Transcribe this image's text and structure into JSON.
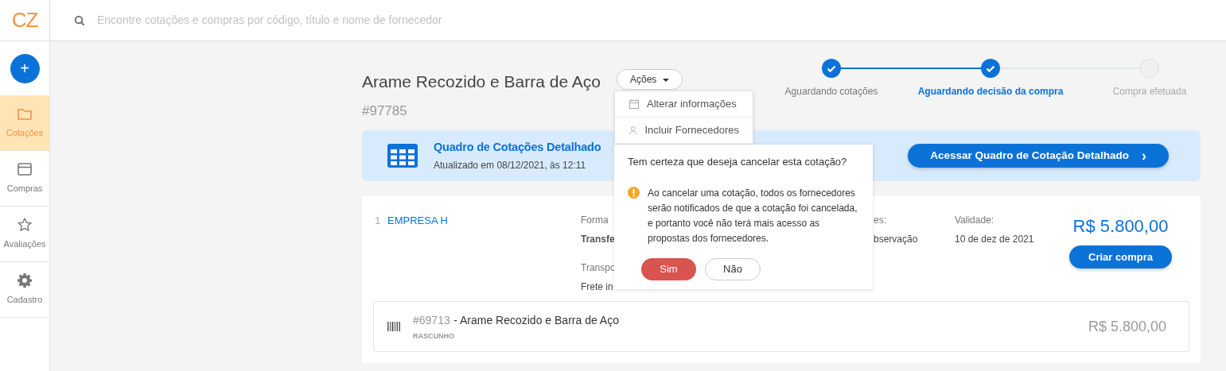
{
  "logo": {
    "text": "CZ"
  },
  "search": {
    "placeholder": "Encontre cotações e compras por código, título e nome de fornecedor"
  },
  "sidebar": {
    "add_button": "+",
    "items": [
      {
        "label": "Cotações",
        "selected": true
      },
      {
        "label": "Compras",
        "selected": false
      },
      {
        "label": "Avaliações",
        "selected": false
      },
      {
        "label": "Cadastro",
        "selected": false
      }
    ]
  },
  "header": {
    "title": "Arame Recozido e Barra de Aço",
    "code": "#97785",
    "actions_button": "Ações"
  },
  "actions_menu": {
    "items": [
      {
        "label": "Alterar informações"
      },
      {
        "label": "Incluir Fornecedores"
      }
    ],
    "confirm": {
      "question": "Tem certeza que deseja cancelar esta cotação?",
      "warning": "Ao cancelar uma cotação, todos os fornecedores serão notificados de que a cotação foi cancelada, e portanto você não terá mais acesso as propostas dos fornecedores.",
      "buttons": [
        {
          "label": "Sim",
          "kind": "danger"
        },
        {
          "label": "Não",
          "kind": "outline"
        }
      ]
    }
  },
  "steps": [
    {
      "label": "Aguardando cotações",
      "done": true,
      "selected": false
    },
    {
      "label": "Aguardando decisão da compra",
      "done": true,
      "selected": true
    },
    {
      "label": "Compra efetuada",
      "done": false,
      "selected": false
    }
  ],
  "banner": {
    "title": "Quadro de Cotações Detalhado",
    "subtitle": "Atualizado em 08/12/2021, às 12:11",
    "button": "Acessar Quadro de Cotação Detalhado",
    "button_icon": "›"
  },
  "supplier": {
    "index": "1",
    "name": "EMPRESA H",
    "columns": [
      {
        "lines": [
          {
            "text": "Forma",
            "kind": "label"
          },
          {
            "text": "Transfe",
            "kind": "strong"
          },
          {
            "text": "Transpo",
            "kind": "label"
          },
          {
            "text": "Frete in",
            "kind": "value"
          }
        ]
      },
      {
        "lines": [
          {
            "text": "es:",
            "kind": "label"
          },
          {
            "text": "bservação",
            "kind": "value"
          }
        ]
      },
      {
        "lines": [
          {
            "text": "Validade:",
            "kind": "label"
          },
          {
            "text": "10 de dez de 2021",
            "kind": "value"
          }
        ]
      }
    ],
    "price": "R$ 5.800,00",
    "button": "Criar compra",
    "item": {
      "code": "#69713",
      "name": "- Arame Recozido e Barra de Aço",
      "status": "RASCUNHO",
      "price": "R$ 5.800,00"
    }
  }
}
